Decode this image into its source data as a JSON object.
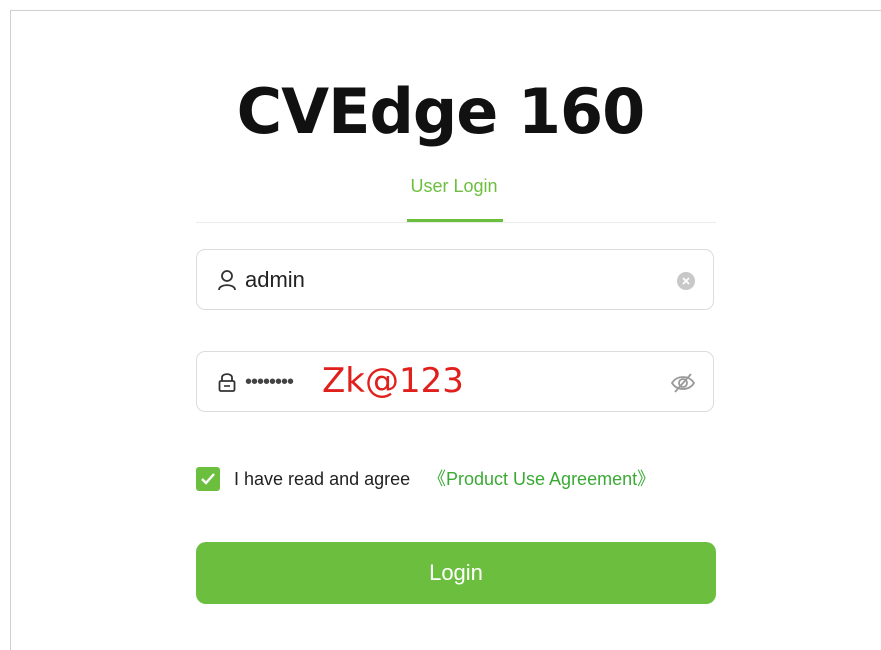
{
  "app": {
    "title": "CVEdge 160"
  },
  "tabs": [
    {
      "label": "User Login",
      "active": true
    }
  ],
  "username": {
    "value": "admin",
    "icon": "user-icon",
    "action_icon": "clear-icon"
  },
  "password": {
    "masked": "••••••••",
    "icon": "lock-icon",
    "action_icon": "eye-off-icon"
  },
  "annotation": {
    "text": "Zk@123",
    "color": "#e0201c"
  },
  "agreement": {
    "checked": true,
    "text": "I have read and agree",
    "link": "《Product Use Agreement》"
  },
  "login_button": {
    "label": "Login"
  },
  "colors": {
    "accent": "#6cbf3e",
    "link": "#3aaa35"
  }
}
